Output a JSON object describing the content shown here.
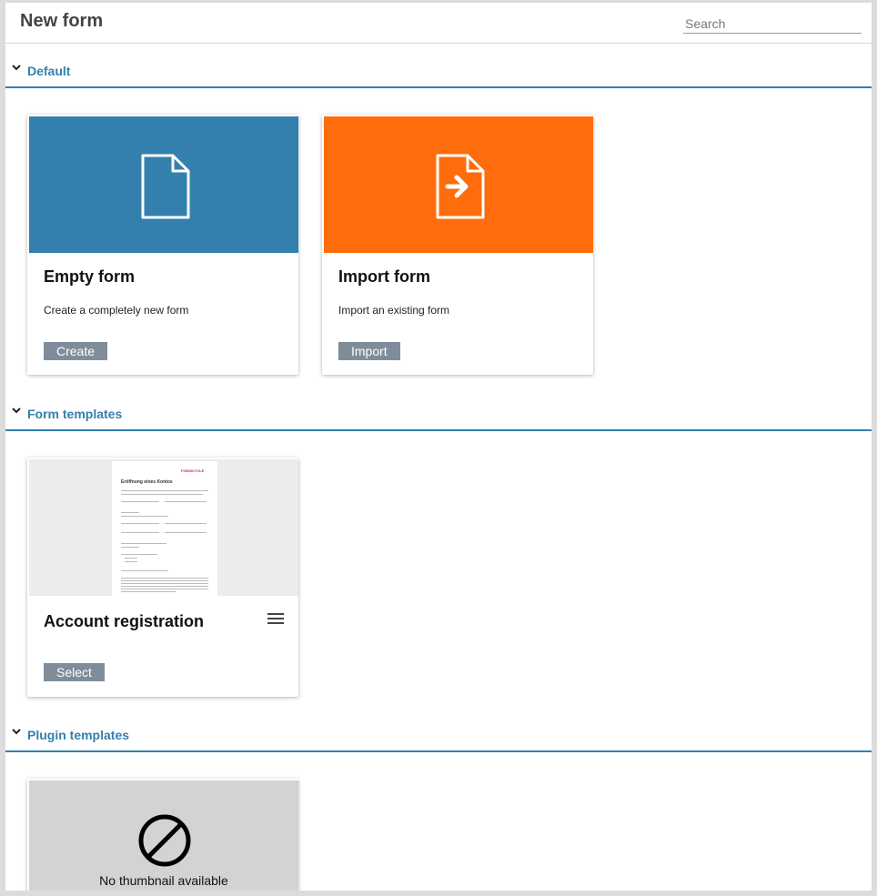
{
  "header": {
    "title": "New form",
    "search_placeholder": "Search"
  },
  "sections": {
    "default": {
      "title": "Default",
      "cards": {
        "empty": {
          "name": "Empty form",
          "description": "Create a completely new form",
          "button": "Create"
        },
        "import": {
          "name": "Import form",
          "description": "Import an existing form",
          "button": "Import"
        }
      }
    },
    "form_templates": {
      "title": "Form templates",
      "cards": {
        "account": {
          "name": "Account registration",
          "button": "Select",
          "thumbnail_title": "Eröffnung eines Kontos",
          "thumbnail_logo": "FORMCYCLE"
        }
      }
    },
    "plugin_templates": {
      "title": "Plugin templates",
      "cards": {
        "plugin": {
          "no_thumbnail": "No thumbnail available"
        }
      }
    }
  },
  "colors": {
    "accent": "#3380ae",
    "empty_card_bg": "#3380ae",
    "import_card_bg": "#ff6c0b",
    "button_bg": "#7f8d9a",
    "template_thumb_bg": "#ececec",
    "no_thumb_bg": "#d3d3d3"
  },
  "icons": {
    "section_toggle": "chevron-down-icon",
    "empty_form": "document-icon",
    "import_form": "document-import-arrow-icon",
    "card_menu": "hamburger-menu-icon",
    "no_thumbnail": "prohibited-icon"
  }
}
